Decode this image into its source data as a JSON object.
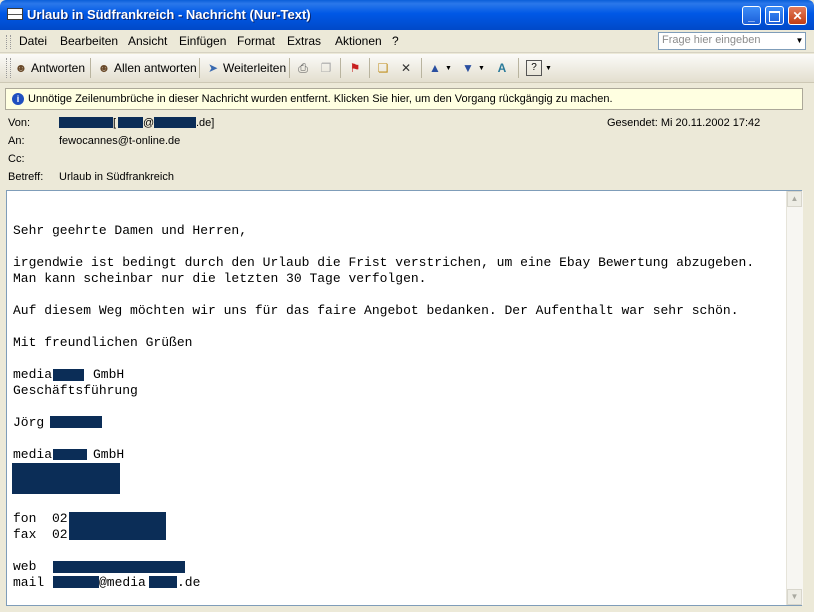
{
  "window": {
    "title": "Urlaub in Südfrankreich - Nachricht (Nur-Text)"
  },
  "menu": [
    "Datei",
    "Bearbeiten",
    "Ansicht",
    "Einfügen",
    "Format",
    "Extras",
    "Aktionen",
    "?"
  ],
  "help": {
    "placeholder": "Frage hier eingeben"
  },
  "toolbar": {
    "reply": "Antworten",
    "reply_all": "Allen antworten",
    "forward": "Weiterleiten"
  },
  "infobar": {
    "text": "Unnötige Zeilenumbrüche in dieser Nachricht wurden entfernt. Klicken Sie hier, um den Vorgang rückgängig zu machen."
  },
  "header": {
    "from_label": "Von:",
    "from_open": "[",
    "from_at": "@",
    "from_domain": ".de]",
    "to_label": "An:",
    "to_value": "fewocannes@t-online.de",
    "cc_label": "Cc:",
    "subject_label": "Betreff:",
    "subject_value": "Urlaub in Südfrankreich",
    "sent": "Gesendet: Mi 20.11.2002 17:42"
  },
  "body": {
    "greeting": "Sehr geehrte Damen und Herren,",
    "line1": "irgendwie ist bedingt durch den Urlaub die Frist verstrichen, um eine Ebay Bewertung abzugeben.",
    "line2": "Man kann scheinbar nur die letzten 30 Tage verfolgen.",
    "line3": "Auf diesem Weg möchten wir uns für das faire Angebot bedanken. Der Aufenthalt war sehr schön.",
    "closing": "Mit freundlichen Grüßen",
    "company1_a": "media",
    "company1_b": "GmbH",
    "dept": "Geschäftsführung",
    "name": "Jörg",
    "company2_a": "media",
    "company2_b": "GmbH",
    "fon": "fon  02",
    "fax": "fax  02",
    "web": "web",
    "mail_a": "mail",
    "mail_b": "@media",
    "mail_c": ".de"
  }
}
